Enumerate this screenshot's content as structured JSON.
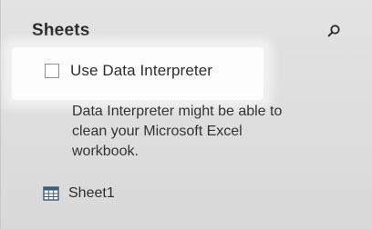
{
  "panel": {
    "title": "Sheets",
    "search_icon": "search-icon"
  },
  "data_interpreter": {
    "checkbox_label": "Use Data Interpreter",
    "checked": false,
    "description_lines": [
      "Data Interpreter might be able to",
      "clean your Microsoft Excel",
      "workbook."
    ]
  },
  "sheets": [
    {
      "label": "Sheet1",
      "icon": "table-grid-icon"
    }
  ],
  "colors": {
    "background": "#dcdcdc",
    "highlight": "#ffffff",
    "text": "#2b2b2b",
    "icon": "#3e5b7a"
  }
}
